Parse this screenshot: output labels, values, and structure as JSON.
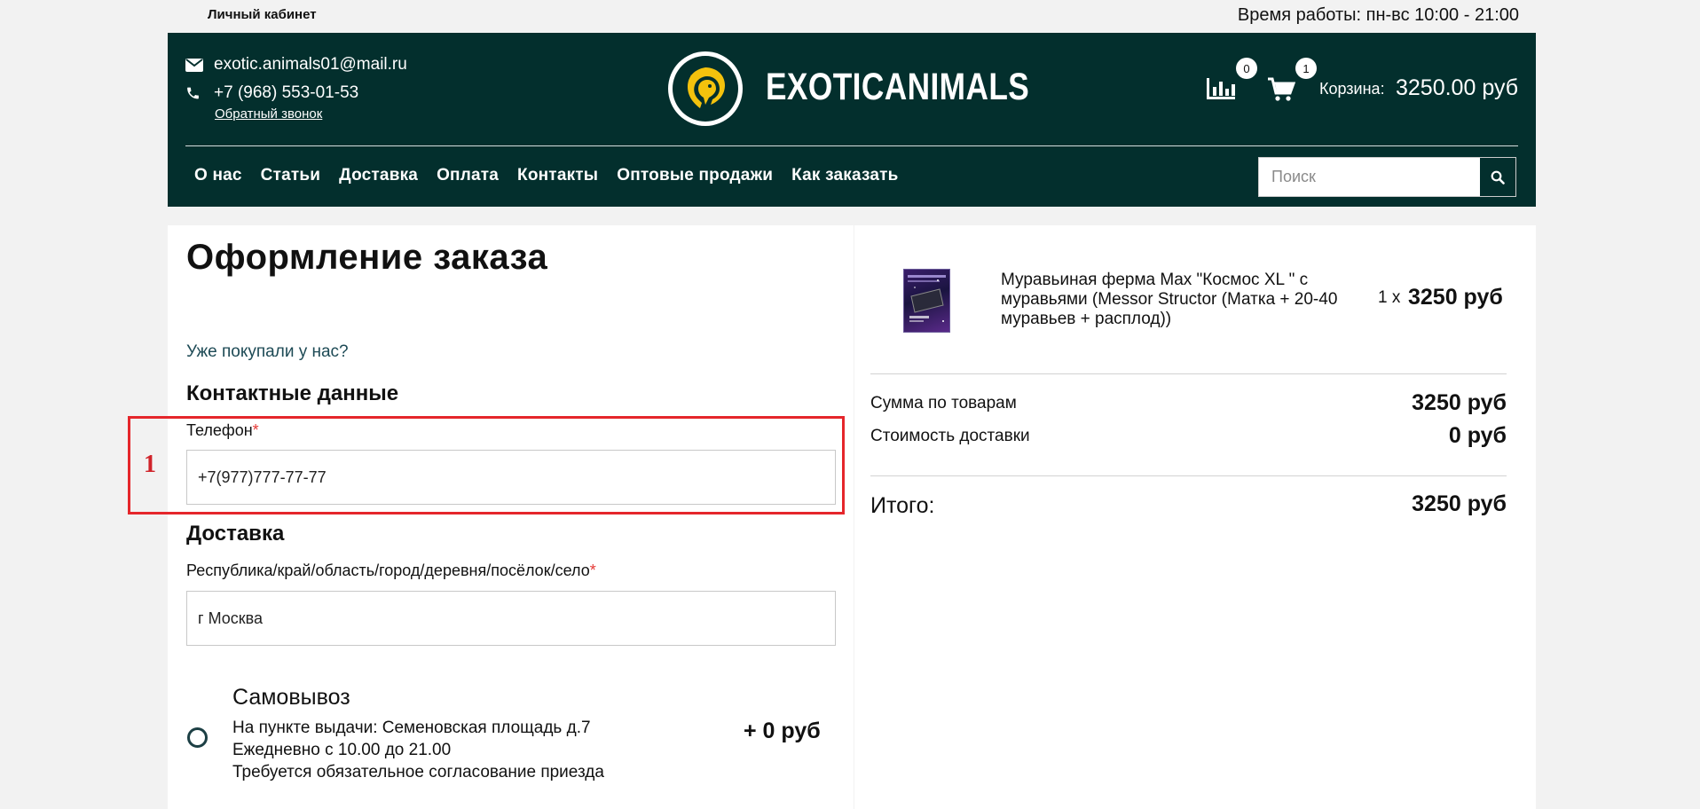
{
  "topbar": {
    "account_link": "Личный кабинет",
    "hours": "Время работы: пн-вс 10:00 - 21:00"
  },
  "header": {
    "email": "exotic.animals01@mail.ru",
    "phone": "+7 (968) 553-01-53",
    "callback": "Обратный звонок",
    "brand": "EXOTICANIMALS",
    "compare_count": "0",
    "cart_count": "1",
    "cart_label": "Корзина:",
    "cart_total": "3250.00 руб",
    "icons": [
      "envelope-icon",
      "phone-icon",
      "lion-logo",
      "bar-chart-icon",
      "cart-icon",
      "search-icon"
    ]
  },
  "nav": {
    "items": [
      "О нас",
      "Статьи",
      "Доставка",
      "Оплата",
      "Контакты",
      "Оптовые продажи",
      "Как заказать"
    ]
  },
  "search": {
    "placeholder": "Поиск"
  },
  "checkout": {
    "title": "Оформление заказа",
    "returning_link": "Уже покупали у нас?",
    "contact_section": "Контактные данные",
    "phone_label": "Телефон",
    "required_mark": "*",
    "phone_value": "+7(977)777-77-77",
    "delivery_section": "Доставка",
    "region_label": "Республика/край/область/город/деревня/посёлок/село",
    "region_value": "г Москва",
    "annotation_number": "1",
    "pickup": {
      "title": "Самовывоз",
      "line1": "На пункте выдачи: Семеновская площадь д.7",
      "line2": "Ежедневно с 10.00 до 21.00",
      "line3": "Требуется обязательное согласование приезда",
      "price": "+ 0 руб",
      "selected": false
    }
  },
  "order_summary": {
    "product_name": "Муравьиная ферма Max \"Космос XL \" с муравьями (Messor Structor (Матка + 20-40 муравьев + расплод))",
    "product_qty": "1 x",
    "product_price": "3250 руб",
    "goods_sum_label": "Сумма по товарам",
    "goods_sum_value": "3250 руб",
    "delivery_cost_label": "Стоимость доставки",
    "delivery_cost_value": "0 руб",
    "total_label": "Итого:",
    "total_value": "3250 руб"
  },
  "colors": {
    "header_bg": "#032f2d",
    "highlight_red": "#e5262b",
    "required_red": "#e53935"
  }
}
